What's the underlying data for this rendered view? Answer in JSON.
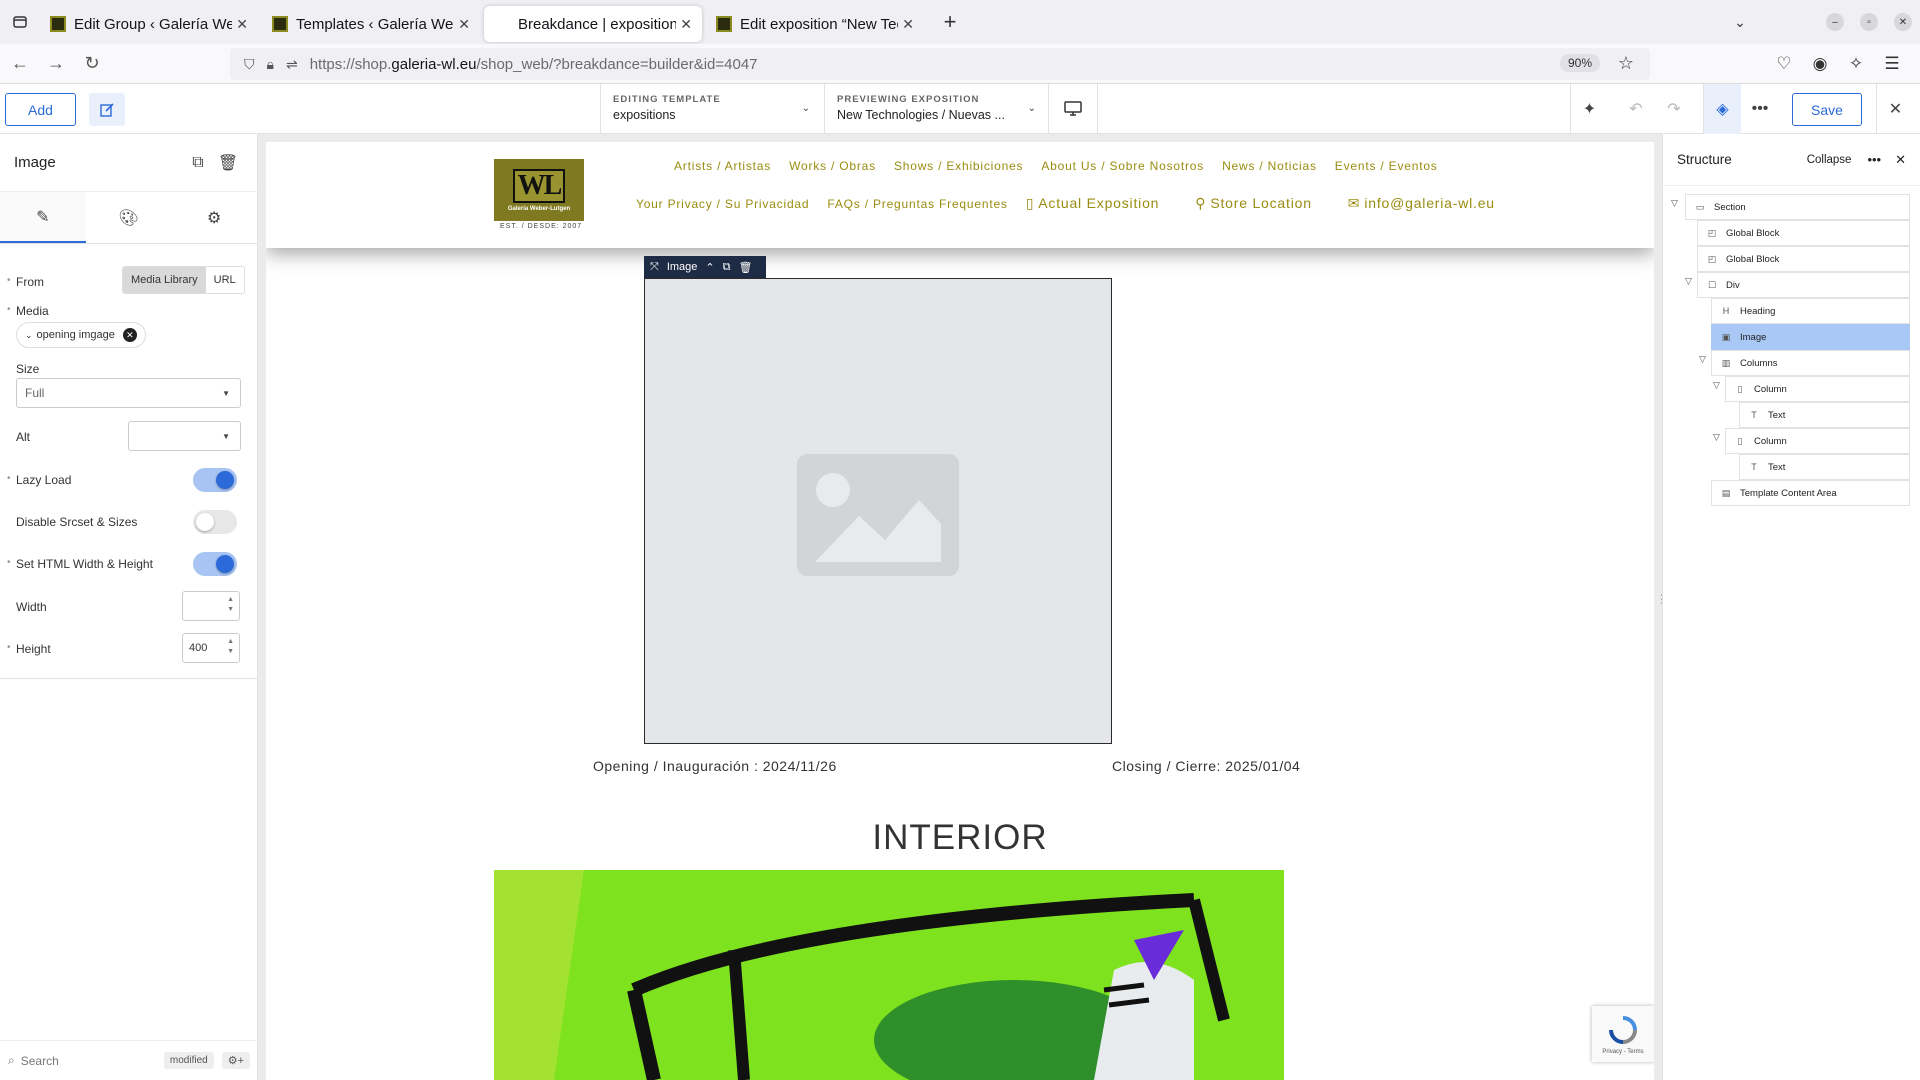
{
  "browser": {
    "tabs": [
      {
        "title": "Edit Group ‹ Galería Web"
      },
      {
        "title": "Templates ‹ Galería Web"
      },
      {
        "title": "Breakdance | expositions"
      },
      {
        "title": "Edit exposition “New Tec"
      }
    ],
    "url_prefix": "https://shop.",
    "url_host": "galeria-wl.eu",
    "url_path": "/shop_web/?breakdance=builder&id=4047",
    "zoom": "90%"
  },
  "toolbar": {
    "add_label": "Add",
    "editing_template_label": "EDITING TEMPLATE",
    "editing_template_value": "expositions",
    "previewing_label": "PREVIEWING EXPOSITION",
    "previewing_value": "New Technologies / Nuevas ...",
    "save_label": "Save"
  },
  "properties": {
    "title": "Image",
    "from_label": "From",
    "from_options": [
      "Media Library",
      "URL"
    ],
    "media_label": "Media",
    "media_value": "opening imgage",
    "size_label": "Size",
    "size_value": "Full",
    "alt_label": "Alt",
    "lazy_load_label": "Lazy Load",
    "lazy_load": true,
    "disable_srcset_label": "Disable Srcset & Sizes",
    "disable_srcset": false,
    "set_html_wh_label": "Set HTML Width & Height",
    "set_html_wh": true,
    "width_label": "Width",
    "width_value": "",
    "height_label": "Height",
    "height_value": "400",
    "search_placeholder": "Search",
    "modified_badge": "modified"
  },
  "site": {
    "logo_text": "WL",
    "logo_sub": "Galería Weber-Lutgen",
    "logo_est": "EST. / DESDE: 2007",
    "menu_row1": [
      "Artists / Artistas",
      "Works / Obras",
      "Shows / Exhibiciones",
      "About Us / Sobre Nosotros",
      "News / Noticias",
      "Events / Eventos"
    ],
    "menu_row2": [
      "Your Privacy / Su Privacidad",
      "FAQs / Preguntas Frequentes"
    ],
    "menu_row2_icons": [
      "Actual Exposition",
      "Store Location",
      "info@galeria-wl.eu"
    ],
    "selected_element_label": "Image",
    "opening_text": "Opening / Inauguración : 2024/11/26",
    "closing_text": "Closing / Cierre: 2025/01/04",
    "heading": "INTERIOR",
    "recaptcha_text": "Privacy - Terms"
  },
  "structure": {
    "title": "Structure",
    "collapse_label": "Collapse",
    "items": [
      {
        "label": "Section",
        "icon": "section-icon"
      },
      {
        "label": "Global Block",
        "icon": "global-block-icon"
      },
      {
        "label": "Global Block",
        "icon": "global-block-icon"
      },
      {
        "label": "Div",
        "icon": "div-icon"
      },
      {
        "label": "Heading",
        "icon": "heading-icon"
      },
      {
        "label": "Image",
        "icon": "image-icon"
      },
      {
        "label": "Columns",
        "icon": "columns-icon"
      },
      {
        "label": "Column",
        "icon": "column-icon"
      },
      {
        "label": "Text",
        "icon": "text-icon"
      },
      {
        "label": "Column",
        "icon": "column-icon"
      },
      {
        "label": "Text",
        "icon": "text-icon"
      },
      {
        "label": "Template Content Area",
        "icon": "template-area-icon"
      }
    ]
  },
  "colors": {
    "accent": "#2b6ad8",
    "menu_gold": "#9a8c10",
    "painting_green": "#7ee21e",
    "selection_blue": "#a9c8f5"
  }
}
